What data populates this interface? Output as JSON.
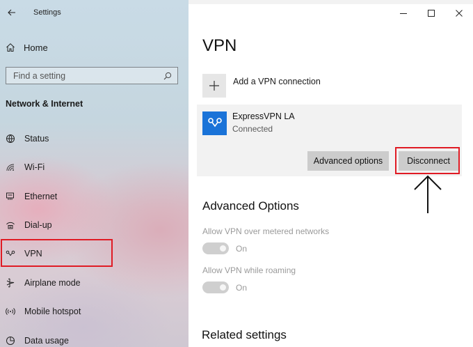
{
  "window": {
    "title": "Settings"
  },
  "sidebar": {
    "home_label": "Home",
    "search_placeholder": "Find a setting",
    "section_title": "Network & Internet",
    "items": [
      {
        "label": "Status",
        "icon": "globe-icon"
      },
      {
        "label": "Wi-Fi",
        "icon": "wifi-icon"
      },
      {
        "label": "Ethernet",
        "icon": "ethernet-icon"
      },
      {
        "label": "Dial-up",
        "icon": "dialup-icon"
      },
      {
        "label": "VPN",
        "icon": "vpn-icon",
        "selected": true
      },
      {
        "label": "Airplane mode",
        "icon": "airplane-icon"
      },
      {
        "label": "Mobile hotspot",
        "icon": "hotspot-icon"
      },
      {
        "label": "Data usage",
        "icon": "data-usage-icon"
      }
    ]
  },
  "main": {
    "title": "VPN",
    "add_vpn_label": "Add a VPN connection",
    "connection": {
      "name": "ExpressVPN LA",
      "status": "Connected",
      "advanced_button": "Advanced options",
      "disconnect_button": "Disconnect"
    },
    "advanced_options": {
      "title": "Advanced Options",
      "metered": {
        "label": "Allow VPN over metered networks",
        "state": "On"
      },
      "roaming": {
        "label": "Allow VPN while roaming",
        "state": "On"
      }
    },
    "related_settings_title": "Related settings"
  },
  "colors": {
    "highlight": "#e01b24",
    "vpn_logo": "#1a73d8",
    "button": "#cccccc",
    "card": "#f2f2f2"
  }
}
